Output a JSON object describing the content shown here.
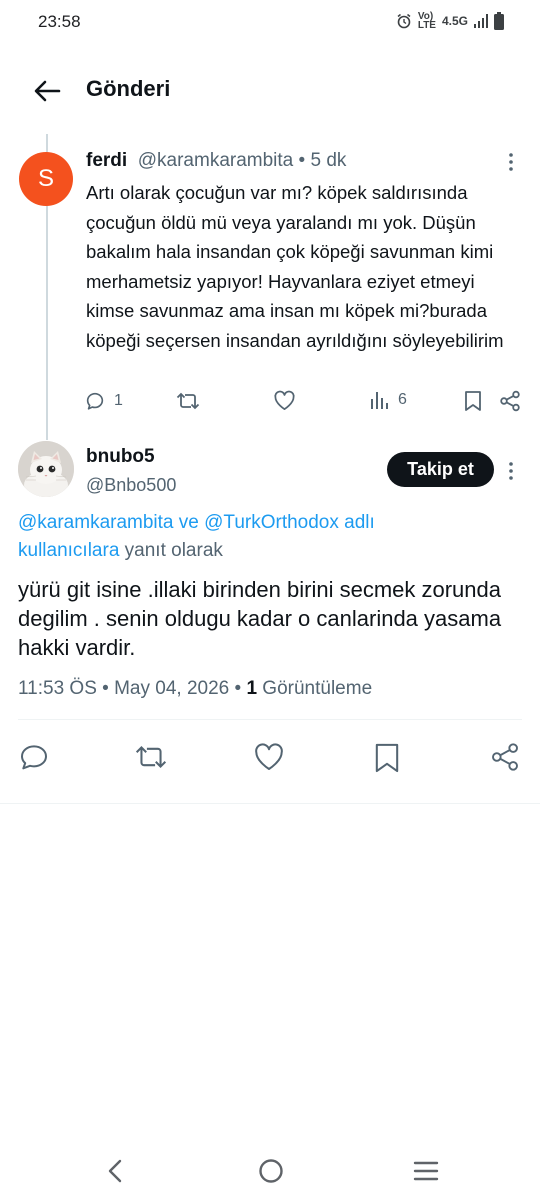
{
  "status_bar": {
    "time": "23:58",
    "net_top": "Vo)",
    "net_lte": "LTE",
    "net_type": "4.5G",
    "icons": [
      "alarm-icon",
      "signal-icon",
      "battery-icon"
    ]
  },
  "header": {
    "title": "Gönderi",
    "back_icon": "arrow-left-icon"
  },
  "parent_tweet": {
    "avatar_letter": "S",
    "avatar_color": "#f4511e",
    "name": "ferdi",
    "handle": "@karamkarambita",
    "separator": " • ",
    "time": "5 dk",
    "text": "Artı olarak çocuğun var mı? köpek saldırısında çocuğun öldü mü veya yaralandı mı yok. Düşün bakalım hala insandan çok köpeği savunman kimi merhametsiz yapıyor! Hayvanlara eziyet etmeyi kimse savunmaz ama insan mı köpek mi?burada köpeği seçersen insandan ayrıldığını söyleyebilirim",
    "reply_count": "1",
    "views_count": "6"
  },
  "main_tweet": {
    "name": "bnubo5",
    "handle": "@Bnbo500",
    "follow_label": "Takip et",
    "reply_mention_1": "@karamkarambita",
    "reply_connector": " ve ",
    "reply_mention_2": "@TurkOrthodox",
    "reply_link_tail": " adlı kullanıcılara",
    "reply_suffix": " yanıt olarak",
    "text": "yürü git isine .illaki birinden birini secmek zorunda degilim . senin oldugu kadar o canlarinda yasama hakki vardir.",
    "time": "11:53 ÖS",
    "dot": " • ",
    "date": "May 04, 2026",
    "views_count": "1",
    "views_label": " Görüntüleme"
  },
  "colors": {
    "link": "#1d9bf0",
    "muted": "#536471",
    "text": "#0f1419",
    "divider": "#eff3f4"
  }
}
